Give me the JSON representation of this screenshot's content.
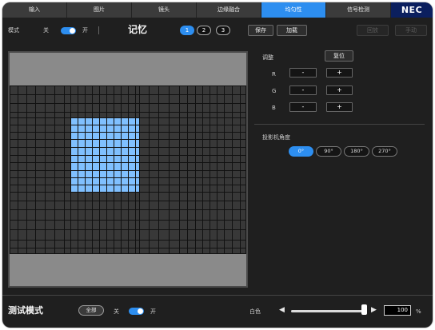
{
  "tabs": [
    {
      "label": "输入",
      "active": false
    },
    {
      "label": "图片",
      "active": false
    },
    {
      "label": "镜头",
      "active": false
    },
    {
      "label": "边缘融合",
      "active": false
    },
    {
      "label": "均匀性",
      "active": true
    },
    {
      "label": "信号检测",
      "active": false
    }
  ],
  "brand": {
    "logo": "NEC"
  },
  "mode": {
    "label": "模式",
    "off_label": "关",
    "on_label": "开",
    "state": "on"
  },
  "memory": {
    "title": "记忆",
    "slots": [
      {
        "label": "1",
        "active": true
      },
      {
        "label": "2",
        "active": false
      },
      {
        "label": "3",
        "active": false
      }
    ],
    "save_label": "保存",
    "load_label": "加载"
  },
  "actions": [
    {
      "label": "回放",
      "enabled": false
    },
    {
      "label": "手动",
      "enabled": false
    }
  ],
  "adjust": {
    "title": "调整",
    "reset_label": "复位",
    "channels": [
      {
        "name": "R",
        "minus": "-",
        "plus": "+"
      },
      {
        "name": "G",
        "minus": "-",
        "plus": "+"
      },
      {
        "name": "B",
        "minus": "-",
        "plus": "+"
      }
    ]
  },
  "projector_angle": {
    "title": "投影机角度",
    "options": [
      {
        "label": "0°",
        "active": true
      },
      {
        "label": "90°",
        "active": false
      },
      {
        "label": "180°",
        "active": false
      },
      {
        "label": "270°",
        "active": false
      }
    ]
  },
  "test_pattern": {
    "title": "测试模式",
    "pattern_label": "全部",
    "off_label": "关",
    "on_label": "开",
    "state": "on"
  },
  "level": {
    "label": "白色",
    "value": "100",
    "unit": "%",
    "fraction": 1.0,
    "decrease_icon": "arrow-left-icon",
    "increase_icon": "arrow-right-icon"
  },
  "colors": {
    "accent": "#2d8ef0",
    "brand": "#0b1f5e",
    "selection": "#80c0ff",
    "panel": "#1f1f1f",
    "grid": "#383838",
    "frame": "#8a8a8a"
  }
}
